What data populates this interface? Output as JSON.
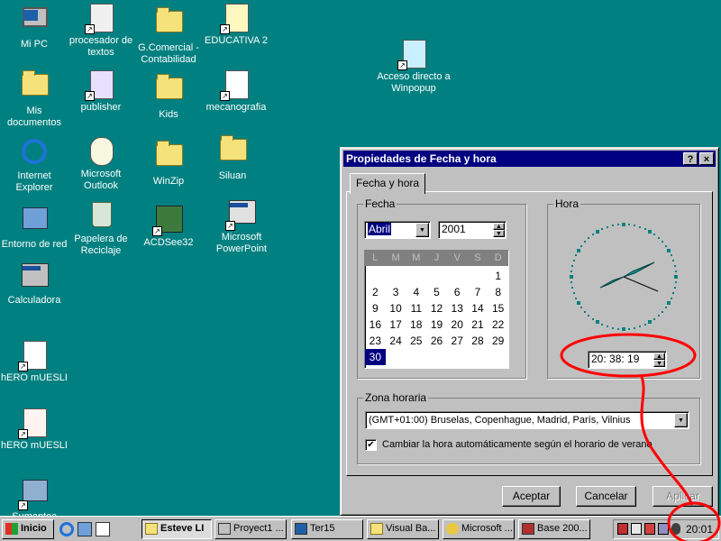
{
  "desktop": {
    "icons": [
      {
        "label": "Mi PC"
      },
      {
        "label": "procesador de textos"
      },
      {
        "label": "G.Comercial - Contabilidad"
      },
      {
        "label": "EDUCATIVA 2"
      },
      {
        "label": "Mis documentos"
      },
      {
        "label": "publisher"
      },
      {
        "label": "Kids"
      },
      {
        "label": "mecanografia"
      },
      {
        "label": "Internet Explorer"
      },
      {
        "label": "Microsoft Outlook"
      },
      {
        "label": "WinZip"
      },
      {
        "label": "Siluan"
      },
      {
        "label": "Entorno de red"
      },
      {
        "label": "Papelera de Reciclaje"
      },
      {
        "label": "ACDSee32"
      },
      {
        "label": "Microsoft PowerPoint"
      },
      {
        "label": "Calculadora"
      },
      {
        "label": "hERO mUESLI"
      },
      {
        "label": "hERO mUESLI"
      },
      {
        "label": "Sumantec"
      },
      {
        "label": "Acceso directo a Winpopup"
      }
    ]
  },
  "dialog": {
    "title": "Propiedades de Fecha y hora",
    "help_btn": "?",
    "close_btn": "×",
    "tab": "Fecha y hora",
    "fecha_label": "Fecha",
    "month_value": "Abril",
    "year_value": "2001",
    "weekdays": [
      "L",
      "M",
      "M",
      "J",
      "V",
      "S",
      "D"
    ],
    "calendar_rows": [
      [
        "",
        "",
        "",
        "",
        "",
        "",
        "1"
      ],
      [
        "2",
        "3",
        "4",
        "5",
        "6",
        "7",
        "8"
      ],
      [
        "9",
        "10",
        "11",
        "12",
        "13",
        "14",
        "15"
      ],
      [
        "16",
        "17",
        "18",
        "19",
        "20",
        "21",
        "22"
      ],
      [
        "23",
        "24",
        "25",
        "26",
        "27",
        "28",
        "29"
      ],
      [
        "30",
        "",
        "",
        "",
        "",
        "",
        ""
      ]
    ],
    "selected_day": "30",
    "hora_label": "Hora",
    "time_value": "20: 38: 19",
    "timezone_label": "Zona horaria",
    "timezone_value": "(GMT+01:00) Bruselas, Copenhague, Madrid, París, Vilnius",
    "dst_checkbox_label": "Cambiar la hora automáticamente según el horario de verano",
    "dst_checked": true,
    "accept_btn": "Aceptar",
    "cancel_btn": "Cancelar",
    "apply_btn": "Aplicar"
  },
  "taskbar": {
    "start_label": "Inicio",
    "tasks": [
      {
        "label": "Esteve LI"
      },
      {
        "label": "Proyect1 ..."
      },
      {
        "label": "Ter15"
      },
      {
        "label": "Visual Ba..."
      },
      {
        "label": "Microsoft ..."
      },
      {
        "label": "Base 200..."
      }
    ],
    "clock": "20:01"
  },
  "colors": {
    "desktop": "#008080",
    "titlebar": "#000080",
    "annotation": "#ff0000"
  }
}
